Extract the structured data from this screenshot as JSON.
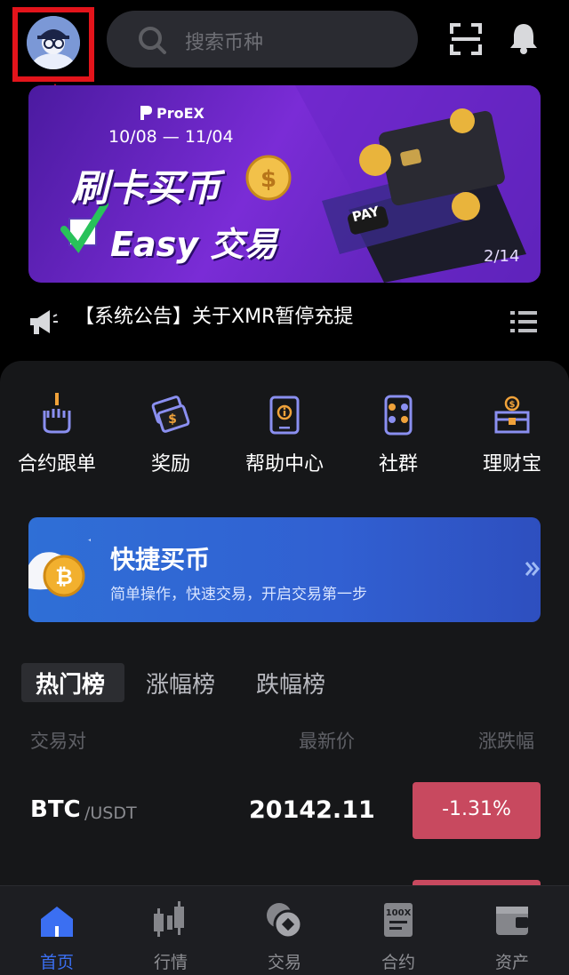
{
  "search": {
    "placeholder": "搜索币种"
  },
  "banner": {
    "brand": "ProEX",
    "date_range": "10/08 — 11/04",
    "headline": "刷卡买币",
    "subline": "Easy 交易",
    "card_button": "PAY",
    "page_indicator": "2/14"
  },
  "announcement": {
    "text": "【系统公告】关于XMR暂停充提"
  },
  "shortcuts": [
    {
      "label": "合约跟单",
      "icon": "hand-chart-icon"
    },
    {
      "label": "奖励",
      "icon": "reward-ticket-icon"
    },
    {
      "label": "帮助中心",
      "icon": "help-tablet-icon"
    },
    {
      "label": "社群",
      "icon": "social-apps-icon"
    },
    {
      "label": "理财宝",
      "icon": "treasure-chest-icon"
    }
  ],
  "quick_buy": {
    "title": "快捷买币",
    "subtitle": "简单操作，快速交易，开启交易第一步"
  },
  "market_tabs": [
    "热门榜",
    "涨幅榜",
    "跌幅榜"
  ],
  "columns": {
    "pair": "交易对",
    "price": "最新价",
    "change": "涨跌幅"
  },
  "rows": [
    {
      "base": "BTC",
      "quote": "/USDT",
      "price": "20142.11",
      "change": "-1.31%"
    }
  ],
  "bottom_nav": [
    {
      "label": "首页",
      "active": true
    },
    {
      "label": "行情",
      "active": false
    },
    {
      "label": "交易",
      "active": false
    },
    {
      "label": "合约",
      "active": false
    },
    {
      "label": "资产",
      "active": false
    }
  ],
  "colors": {
    "accent": "#3b6ff2",
    "negative": "#c8495f",
    "annotation": "#e3141b"
  }
}
